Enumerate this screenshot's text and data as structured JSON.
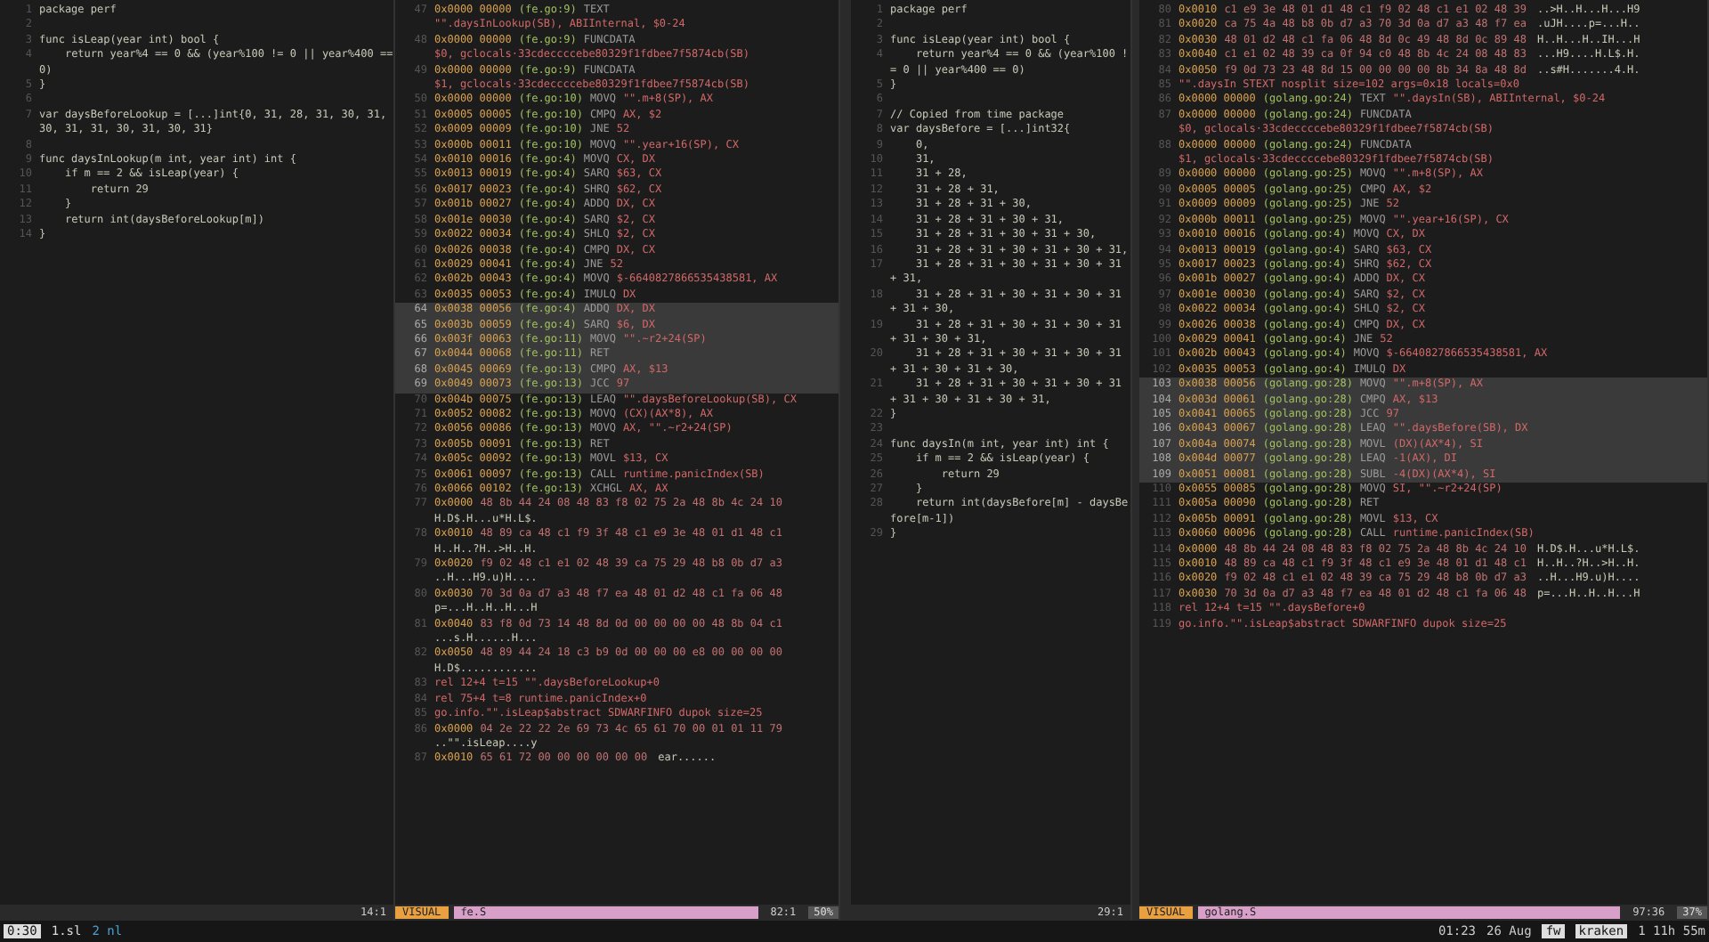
{
  "panes": [
    {
      "kind": "code",
      "lines": [
        {
          "number": "1",
          "text": "package perf"
        },
        {
          "number": "2"
        },
        {
          "number": "3",
          "text": "func isLeap(year int) bool {"
        },
        {
          "number": "4",
          "text": "    return year%4 == 0 && (year%100 != 0 || year%400 == 0)"
        },
        {
          "number": "5",
          "text": "}"
        },
        {
          "number": "6"
        },
        {
          "number": "7",
          "text": "var daysBeforeLookup = [...]int{0, 31, 28, 31, 30, 31, 30, 31, 31, 30, 31, 30, 31}"
        },
        {
          "number": "8"
        },
        {
          "number": "9",
          "text": "func daysInLookup(m int, year int) int {"
        },
        {
          "number": "10",
          "text": "    if m == 2 && isLeap(year) {"
        },
        {
          "number": "11",
          "text": "        return 29"
        },
        {
          "number": "12",
          "text": "    }"
        },
        {
          "number": "13",
          "text": "    return int(daysBeforeLookup[m])"
        },
        {
          "number": "14",
          "text": "}"
        }
      ],
      "status": {
        "position": "14:1"
      }
    },
    {
      "kind": "asm",
      "lines": [
        {
          "kind": "instr",
          "number": "47",
          "address": "0x0000 00000",
          "source": "(fe.go:9)",
          "op": "TEXT",
          "operands": "\"\".daysInLookup(SB), ABIInternal, $0-24",
          "selected": false
        },
        {
          "kind": "instr",
          "number": "48",
          "address": "0x0000 00000",
          "source": "(fe.go:9)",
          "op": "FUNCDATA",
          "operands": "$0, gclocals·33cdeccccebe80329f1fdbee7f5874cb(SB)",
          "selected": false
        },
        {
          "kind": "instr",
          "number": "49",
          "address": "0x0000 00000",
          "source": "(fe.go:9)",
          "op": "FUNCDATA",
          "operands": "$1, gclocals·33cdeccccebe80329f1fdbee7f5874cb(SB)",
          "selected": false
        },
        {
          "kind": "instr",
          "number": "50",
          "address": "0x0000 00000",
          "source": "(fe.go:10)",
          "op": "MOVQ",
          "operands": "\"\".m+8(SP), AX",
          "selected": false
        },
        {
          "kind": "instr",
          "number": "51",
          "address": "0x0005 00005",
          "source": "(fe.go:10)",
          "op": "CMPQ",
          "operands": "AX, $2",
          "selected": false
        },
        {
          "kind": "instr",
          "number": "52",
          "address": "0x0009 00009",
          "source": "(fe.go:10)",
          "op": "JNE",
          "operands": "52",
          "selected": false
        },
        {
          "kind": "instr",
          "number": "53",
          "address": "0x000b 00011",
          "source": "(fe.go:10)",
          "op": "MOVQ",
          "operands": "\"\".year+16(SP), CX",
          "selected": false
        },
        {
          "kind": "instr",
          "number": "54",
          "address": "0x0010 00016",
          "source": "(fe.go:4)",
          "op": "MOVQ",
          "operands": "CX, DX",
          "selected": false
        },
        {
          "kind": "instr",
          "number": "55",
          "address": "0x0013 00019",
          "source": "(fe.go:4)",
          "op": "SARQ",
          "operands": "$63, CX",
          "selected": false
        },
        {
          "kind": "instr",
          "number": "56",
          "address": "0x0017 00023",
          "source": "(fe.go:4)",
          "op": "SHRQ",
          "operands": "$62, CX",
          "selected": false
        },
        {
          "kind": "instr",
          "number": "57",
          "address": "0x001b 00027",
          "source": "(fe.go:4)",
          "op": "ADDQ",
          "operands": "DX, CX",
          "selected": false
        },
        {
          "kind": "instr",
          "number": "58",
          "address": "0x001e 00030",
          "source": "(fe.go:4)",
          "op": "SARQ",
          "operands": "$2, CX",
          "selected": false
        },
        {
          "kind": "instr",
          "number": "59",
          "address": "0x0022 00034",
          "source": "(fe.go:4)",
          "op": "SHLQ",
          "operands": "$2, CX",
          "selected": false
        },
        {
          "kind": "instr",
          "number": "60",
          "address": "0x0026 00038",
          "source": "(fe.go:4)",
          "op": "CMPQ",
          "operands": "DX, CX",
          "selected": false
        },
        {
          "kind": "instr",
          "number": "61",
          "address": "0x0029 00041",
          "source": "(fe.go:4)",
          "op": "JNE",
          "operands": "52",
          "selected": false
        },
        {
          "kind": "instr",
          "number": "62",
          "address": "0x002b 00043",
          "source": "(fe.go:4)",
          "op": "MOVQ",
          "operands": "$-6640827866535438581, AX",
          "selected": false
        },
        {
          "kind": "instr",
          "number": "63",
          "address": "0x0035 00053",
          "source": "(fe.go:4)",
          "op": "IMULQ",
          "operands": "DX",
          "selected": false
        },
        {
          "kind": "instr",
          "number": "64",
          "address": "0x0038 00056",
          "source": "(fe.go:4)",
          "op": "ADDQ",
          "operands": "DX, DX",
          "selected": true
        },
        {
          "kind": "instr",
          "number": "65",
          "address": "0x003b 00059",
          "source": "(fe.go:4)",
          "op": "SARQ",
          "operands": "$6, DX",
          "selected": true
        },
        {
          "kind": "instr",
          "number": "66",
          "address": "0x003f 00063",
          "source": "(fe.go:11)",
          "op": "MOVQ",
          "operands": "\"\".~r2+24(SP)",
          "selected": true
        },
        {
          "kind": "instr",
          "number": "67",
          "address": "0x0044 00068",
          "source": "(fe.go:11)",
          "op": "RET",
          "selected": true
        },
        {
          "kind": "instr",
          "number": "68",
          "address": "0x0045 00069",
          "source": "(fe.go:13)",
          "op": "CMPQ",
          "operands": "AX, $13",
          "selected": true
        },
        {
          "kind": "instr",
          "number": "69",
          "address": "0x0049 00073",
          "source": "(fe.go:13)",
          "op": "JCC",
          "operands": "97",
          "selected": true
        },
        {
          "kind": "instr",
          "number": "70",
          "address": "0x004b 00075",
          "source": "(fe.go:13)",
          "op": "LEAQ",
          "operands": "\"\".daysBeforeLookup(SB), CX",
          "selected": false
        },
        {
          "kind": "instr",
          "number": "71",
          "address": "0x0052 00082",
          "source": "(fe.go:13)",
          "op": "MOVQ",
          "operands": "(CX)(AX*8), AX",
          "selected": false
        },
        {
          "kind": "instr",
          "number": "72",
          "address": "0x0056 00086",
          "source": "(fe.go:13)",
          "op": "MOVQ",
          "operands": "AX, \"\".~r2+24(SP)",
          "selected": false
        },
        {
          "kind": "instr",
          "number": "73",
          "address": "0x005b 00091",
          "source": "(fe.go:13)",
          "op": "RET",
          "selected": false
        },
        {
          "kind": "instr",
          "number": "74",
          "address": "0x005c 00092",
          "source": "(fe.go:13)",
          "op": "MOVL",
          "operands": "$13, CX",
          "selected": false
        },
        {
          "kind": "instr",
          "number": "75",
          "address": "0x0061 00097",
          "source": "(fe.go:13)",
          "op": "CALL",
          "operands": "runtime.panicIndex(SB)",
          "selected": false
        },
        {
          "kind": "instr",
          "number": "76",
          "address": "0x0066 00102",
          "source": "(fe.go:13)",
          "op": "XCHGL",
          "operands": "AX, AX",
          "selected": false
        },
        {
          "kind": "hex",
          "number": "77",
          "address": "0x0000",
          "bytes": "48 8b 44 24 08 48 83 f8 02 75 2a 48 8b 4c 24 10",
          "ascii": "H.D$.H...u*H.L$."
        },
        {
          "kind": "hex",
          "number": "78",
          "address": "0x0010",
          "bytes": "48 89 ca 48 c1 f9 3f 48 c1 e9 3e 48 01 d1 48 c1",
          "ascii": "H..H..?H..>H..H."
        },
        {
          "kind": "hex",
          "number": "79",
          "address": "0x0020",
          "bytes": "f9 02 48 c1 e1 02 48 39 ca 75 29 48 b8 0b d7 a3",
          "ascii": "..H...H9.u)H...."
        },
        {
          "kind": "hex",
          "number": "80",
          "address": "0x0030",
          "bytes": "70 3d 0a d7 a3 48 f7 ea 48 01 d2 48 c1 fa 06 48",
          "ascii": "p=...H..H..H...H"
        },
        {
          "kind": "hex",
          "number": "81",
          "address": "0x0040",
          "bytes": "83 f8 0d 73 14 48 8d 0d 00 00 00 00 48 8b 04 c1",
          "ascii": "...s.H......H..."
        },
        {
          "kind": "hex",
          "number": "82",
          "address": "0x0050",
          "bytes": "48 89 44 24 18 c3 b9 0d 00 00 00 e8 00 00 00 00",
          "ascii": "H.D$............"
        },
        {
          "kind": "header",
          "number": "83",
          "text": "rel 12+4 t=15 \"\".daysBeforeLookup+0"
        },
        {
          "kind": "header",
          "number": "84",
          "text": "rel 75+4 t=8 runtime.panicIndex+0"
        },
        {
          "kind": "header",
          "number": "85",
          "text": "go.info.\"\".isLeap$abstract SDWARFINFO dupok size=25"
        },
        {
          "kind": "hex",
          "number": "86",
          "address": "0x0000",
          "bytes": "04 2e 22 22 2e 69 73 4c 65 61 70 00 01 01 11 79",
          "ascii": "..\"\".isLeap....y"
        },
        {
          "kind": "hex",
          "number": "87",
          "address": "0x0010",
          "bytes": "65 61 72 00 00 00 00 00 00",
          "ascii": "ear......"
        }
      ],
      "status": {
        "mode": "VISUAL",
        "file": "fe.S",
        "position": "82:1",
        "percent": "50%"
      }
    },
    {
      "kind": "code",
      "lines": [
        {
          "number": "1",
          "text": "package perf"
        },
        {
          "number": "2"
        },
        {
          "number": "3",
          "text": "func isLeap(year int) bool {"
        },
        {
          "number": "4",
          "text": "    return year%4 == 0 && (year%100 != 0 || year%400 == 0)"
        },
        {
          "number": "5",
          "text": "}"
        },
        {
          "number": "6"
        },
        {
          "number": "7",
          "text": "// Copied from time package"
        },
        {
          "number": "8",
          "text": "var daysBefore = [...]int32{"
        },
        {
          "number": "9",
          "text": "    0,"
        },
        {
          "number": "10",
          "text": "    31,"
        },
        {
          "number": "11",
          "text": "    31 + 28,"
        },
        {
          "number": "12",
          "text": "    31 + 28 + 31,"
        },
        {
          "number": "13",
          "text": "    31 + 28 + 31 + 30,"
        },
        {
          "number": "14",
          "text": "    31 + 28 + 31 + 30 + 31,"
        },
        {
          "number": "15",
          "text": "    31 + 28 + 31 + 30 + 31 + 30,"
        },
        {
          "number": "16",
          "text": "    31 + 28 + 31 + 30 + 31 + 30 + 31,"
        },
        {
          "number": "17",
          "text": "    31 + 28 + 31 + 30 + 31 + 30 + 31 + 31,"
        },
        {
          "number": "18",
          "text": "    31 + 28 + 31 + 30 + 31 + 30 + 31 + 31 + 30,"
        },
        {
          "number": "19",
          "text": "    31 + 28 + 31 + 30 + 31 + 30 + 31 + 31 + 30 + 31,"
        },
        {
          "number": "20",
          "text": "    31 + 28 + 31 + 30 + 31 + 30 + 31 + 31 + 30 + 31 + 30,"
        },
        {
          "number": "21",
          "text": "    31 + 28 + 31 + 30 + 31 + 30 + 31 + 31 + 30 + 31 + 30 + 31,"
        },
        {
          "number": "22",
          "text": "}"
        },
        {
          "number": "23"
        },
        {
          "number": "24",
          "text": "func daysIn(m int, year int) int {"
        },
        {
          "number": "25",
          "text": "    if m == 2 && isLeap(year) {"
        },
        {
          "number": "26",
          "text": "        return 29"
        },
        {
          "number": "27",
          "text": "    }"
        },
        {
          "number": "28",
          "text": "    return int(daysBefore[m] - daysBefore[m-1])"
        },
        {
          "number": "29",
          "text": "}"
        }
      ],
      "status": {
        "position": "29:1"
      }
    },
    {
      "kind": "asm",
      "lines": [
        {
          "kind": "hex",
          "number": "80",
          "address": "0x0010",
          "bytes": "c1 e9 3e 48 01 d1 48 c1 f9 02 48 c1 e1 02 48 39",
          "ascii": "..>H..H...H...H9"
        },
        {
          "kind": "hex",
          "number": "81",
          "address": "0x0020",
          "bytes": "ca 75 4a 48 b8 0b d7 a3 70 3d 0a d7 a3 48 f7 ea",
          "ascii": ".uJH....p=...H.."
        },
        {
          "kind": "hex",
          "number": "82",
          "address": "0x0030",
          "bytes": "48 01 d2 48 c1 fa 06 48 8d 0c 49 48 8d 0c 89 48",
          "ascii": "H..H...H..IH...H"
        },
        {
          "kind": "hex",
          "number": "83",
          "address": "0x0040",
          "bytes": "c1 e1 02 48 39 ca 0f 94 c0 48 8b 4c 24 08 48 83",
          "ascii": "...H9....H.L$.H."
        },
        {
          "kind": "hex",
          "number": "84",
          "address": "0x0050",
          "bytes": "f9 0d 73 23 48 8d 15 00 00 00 00 8b 34 8a 48 8d",
          "ascii": "..s#H.......4.H."
        },
        {
          "kind": "header",
          "number": "85",
          "text": "\"\".daysIn STEXT nosplit size=102 args=0x18 locals=0x0"
        },
        {
          "kind": "instr",
          "number": "86",
          "address": "0x0000 00000",
          "source": "(golang.go:24)",
          "op": "TEXT",
          "operands": "\"\".daysIn(SB), ABIInternal, $0-24",
          "selected": false
        },
        {
          "kind": "instr",
          "number": "87",
          "address": "0x0000 00000",
          "source": "(golang.go:24)",
          "op": "FUNCDATA",
          "operands": "$0, gclocals·33cdeccccebe80329f1fdbee7f5874cb(SB)",
          "selected": false
        },
        {
          "kind": "instr",
          "number": "88",
          "address": "0x0000 00000",
          "source": "(golang.go:24)",
          "op": "FUNCDATA",
          "operands": "$1, gclocals·33cdeccccebe80329f1fdbee7f5874cb(SB)",
          "selected": false
        },
        {
          "kind": "instr",
          "number": "89",
          "address": "0x0000 00000",
          "source": "(golang.go:25)",
          "op": "MOVQ",
          "operands": "\"\".m+8(SP), AX",
          "selected": false
        },
        {
          "kind": "instr",
          "number": "90",
          "address": "0x0005 00005",
          "source": "(golang.go:25)",
          "op": "CMPQ",
          "operands": "AX, $2",
          "selected": false
        },
        {
          "kind": "instr",
          "number": "91",
          "address": "0x0009 00009",
          "source": "(golang.go:25)",
          "op": "JNE",
          "operands": "52",
          "selected": false
        },
        {
          "kind": "instr",
          "number": "92",
          "address": "0x000b 00011",
          "source": "(golang.go:25)",
          "op": "MOVQ",
          "operands": "\"\".year+16(SP), CX",
          "selected": false
        },
        {
          "kind": "instr",
          "number": "93",
          "address": "0x0010 00016",
          "source": "(golang.go:4)",
          "op": "MOVQ",
          "operands": "CX, DX",
          "selected": false
        },
        {
          "kind": "instr",
          "number": "94",
          "address": "0x0013 00019",
          "source": "(golang.go:4)",
          "op": "SARQ",
          "operands": "$63, CX",
          "selected": false
        },
        {
          "kind": "instr",
          "number": "95",
          "address": "0x0017 00023",
          "source": "(golang.go:4)",
          "op": "SHRQ",
          "operands": "$62, CX",
          "selected": false
        },
        {
          "kind": "instr",
          "number": "96",
          "address": "0x001b 00027",
          "source": "(golang.go:4)",
          "op": "ADDQ",
          "operands": "DX, CX",
          "selected": false
        },
        {
          "kind": "instr",
          "number": "97",
          "address": "0x001e 00030",
          "source": "(golang.go:4)",
          "op": "SARQ",
          "operands": "$2, CX",
          "selected": false
        },
        {
          "kind": "instr",
          "number": "98",
          "address": "0x0022 00034",
          "source": "(golang.go:4)",
          "op": "SHLQ",
          "operands": "$2, CX",
          "selected": false
        },
        {
          "kind": "instr",
          "number": "99",
          "address": "0x0026 00038",
          "source": "(golang.go:4)",
          "op": "CMPQ",
          "operands": "DX, CX",
          "selected": false
        },
        {
          "kind": "instr",
          "number": "100",
          "address": "0x0029 00041",
          "source": "(golang.go:4)",
          "op": "JNE",
          "operands": "52",
          "selected": false
        },
        {
          "kind": "instr",
          "number": "101",
          "address": "0x002b 00043",
          "source": "(golang.go:4)",
          "op": "MOVQ",
          "operands": "$-6640827866535438581, AX",
          "selected": false
        },
        {
          "kind": "instr",
          "number": "102",
          "address": "0x0035 00053",
          "source": "(golang.go:4)",
          "op": "IMULQ",
          "operands": "DX",
          "selected": false
        },
        {
          "kind": "instr",
          "number": "103",
          "address": "0x0038 00056",
          "source": "(golang.go:28)",
          "op": "MOVQ",
          "operands": "\"\".m+8(SP), AX",
          "selected": true
        },
        {
          "kind": "instr",
          "number": "104",
          "address": "0x003d 00061",
          "source": "(golang.go:28)",
          "op": "CMPQ",
          "operands": "AX, $13",
          "selected": true
        },
        {
          "kind": "instr",
          "number": "105",
          "address": "0x0041 00065",
          "source": "(golang.go:28)",
          "op": "JCC",
          "operands": "97",
          "selected": true
        },
        {
          "kind": "instr",
          "number": "106",
          "address": "0x0043 00067",
          "source": "(golang.go:28)",
          "op": "LEAQ",
          "operands": "\"\".daysBefore(SB), DX",
          "selected": true
        },
        {
          "kind": "instr",
          "number": "107",
          "address": "0x004a 00074",
          "source": "(golang.go:28)",
          "op": "MOVL",
          "operands": "(DX)(AX*4), SI",
          "selected": true
        },
        {
          "kind": "instr",
          "number": "108",
          "address": "0x004d 00077",
          "source": "(golang.go:28)",
          "op": "LEAQ",
          "operands": "-1(AX), DI",
          "selected": true
        },
        {
          "kind": "instr",
          "number": "109",
          "address": "0x0051 00081",
          "source": "(golang.go:28)",
          "op": "SUBL",
          "operands": "-4(DX)(AX*4), SI",
          "selected": true
        },
        {
          "kind": "instr",
          "number": "110",
          "address": "0x0055 00085",
          "source": "(golang.go:28)",
          "op": "MOVQ",
          "operands": "SI, \"\".~r2+24(SP)",
          "selected": false
        },
        {
          "kind": "instr",
          "number": "111",
          "address": "0x005a 00090",
          "source": "(golang.go:28)",
          "op": "RET",
          "selected": false
        },
        {
          "kind": "instr",
          "number": "112",
          "address": "0x005b 00091",
          "source": "(golang.go:28)",
          "op": "MOVL",
          "operands": "$13, CX",
          "selected": false
        },
        {
          "kind": "instr",
          "number": "113",
          "address": "0x0060 00096",
          "source": "(golang.go:28)",
          "op": "CALL",
          "operands": "runtime.panicIndex(SB)",
          "selected": false
        },
        {
          "kind": "hex",
          "number": "114",
          "address": "0x0000",
          "bytes": "48 8b 44 24 08 48 83 f8 02 75 2a 48 8b 4c 24 10",
          "ascii": "H.D$.H...u*H.L$."
        },
        {
          "kind": "hex",
          "number": "115",
          "address": "0x0010",
          "bytes": "48 89 ca 48 c1 f9 3f 48 c1 e9 3e 48 01 d1 48 c1",
          "ascii": "H..H..?H..>H..H."
        },
        {
          "kind": "hex",
          "number": "116",
          "address": "0x0020",
          "bytes": "f9 02 48 c1 e1 02 48 39 ca 75 29 48 b8 0b d7 a3",
          "ascii": "..H...H9.u)H...."
        },
        {
          "kind": "hex",
          "number": "117",
          "address": "0x0030",
          "bytes": "70 3d 0a d7 a3 48 f7 ea 48 01 d2 48 c1 fa 06 48",
          "ascii": "p=...H..H..H...H"
        },
        {
          "kind": "header",
          "number": "118",
          "text": "rel 12+4 t=15 \"\".daysBefore+0"
        },
        {
          "kind": "header",
          "number": "119",
          "text": "go.info.\"\".isLeap$abstract SDWARFINFO dupok size=25"
        }
      ],
      "status": {
        "mode": "VISUAL",
        "file": "golang.S",
        "position": "97:36",
        "percent": "37%"
      }
    }
  ],
  "tmux": {
    "session": "0:30",
    "windows": [
      {
        "label": "1.sl",
        "selected": true
      },
      {
        "label": "2 nl",
        "selected": false
      }
    ],
    "time": "01:23",
    "date": "26 Aug",
    "user": "fw",
    "host": "kraken",
    "uptime": "1 11h 55m"
  }
}
